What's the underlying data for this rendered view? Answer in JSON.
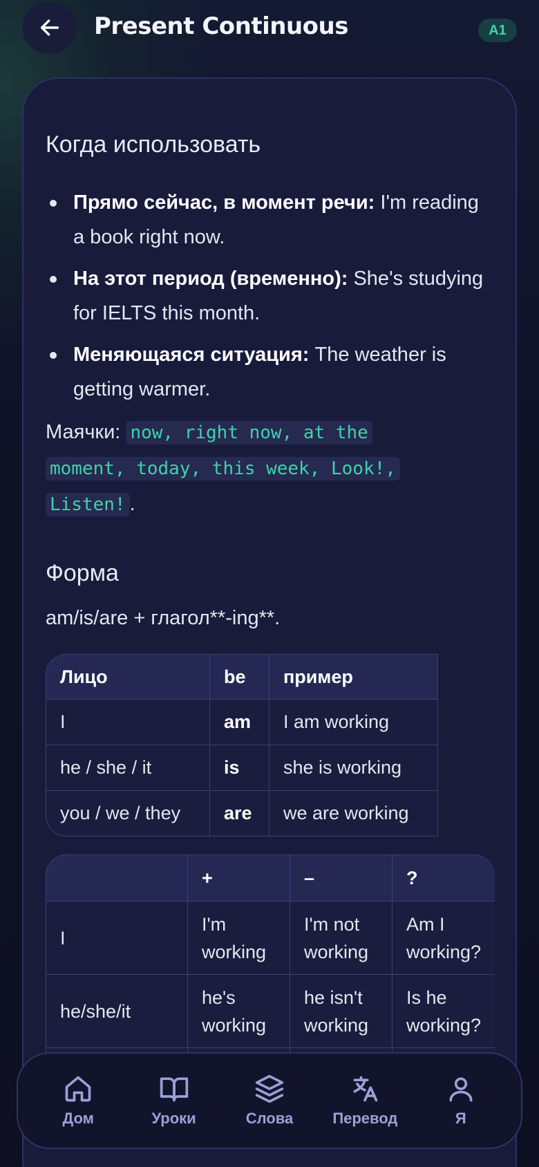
{
  "header": {
    "title": "Present Continuous",
    "level": "A1",
    "back_icon": "arrow-left-icon"
  },
  "usage": {
    "heading": "Когда использовать",
    "bullets": [
      {
        "bold": "Прямо сейчас, в момент речи:",
        "text": " I'm reading a book right now."
      },
      {
        "bold": "На этот период (временно):",
        "text": " She's studying for IELTS this month."
      },
      {
        "bold": "Меняющаяся ситуация:",
        "text": " The weather is getting warmer."
      }
    ],
    "markers_label": "Маячки:",
    "markers_code": "now, right now, at the moment, today, this week, Look!, Listen!",
    "markers_end": "."
  },
  "form": {
    "heading": "Форма",
    "formula": "am/is/are + глагол**-ing**."
  },
  "table_be": {
    "headers": [
      "Лицо",
      "be",
      "пример"
    ],
    "rows": [
      [
        "I",
        "am",
        "I am working"
      ],
      [
        "he / she / it",
        "is",
        "she is working"
      ],
      [
        "you / we / they",
        "are",
        "we are working"
      ]
    ]
  },
  "table_forms": {
    "headers": [
      "",
      "+",
      "–",
      "?"
    ],
    "rows": [
      [
        "I",
        "I'm working",
        "I'm not working",
        "Am I working?"
      ],
      [
        "he/she/it",
        "he's working",
        "he isn't working",
        "Is he working?"
      ]
    ]
  },
  "nav": {
    "items": [
      {
        "label": "Дом",
        "icon": "home-icon"
      },
      {
        "label": "Уроки",
        "icon": "book-icon"
      },
      {
        "label": "Слова",
        "icon": "layers-icon"
      },
      {
        "label": "Перевод",
        "icon": "translate-icon"
      },
      {
        "label": "Я",
        "icon": "user-icon"
      }
    ]
  },
  "colors": {
    "accent": "#3fd1ad",
    "nav_icon": "#9aa1d6",
    "card_bg": "#181b3a"
  }
}
